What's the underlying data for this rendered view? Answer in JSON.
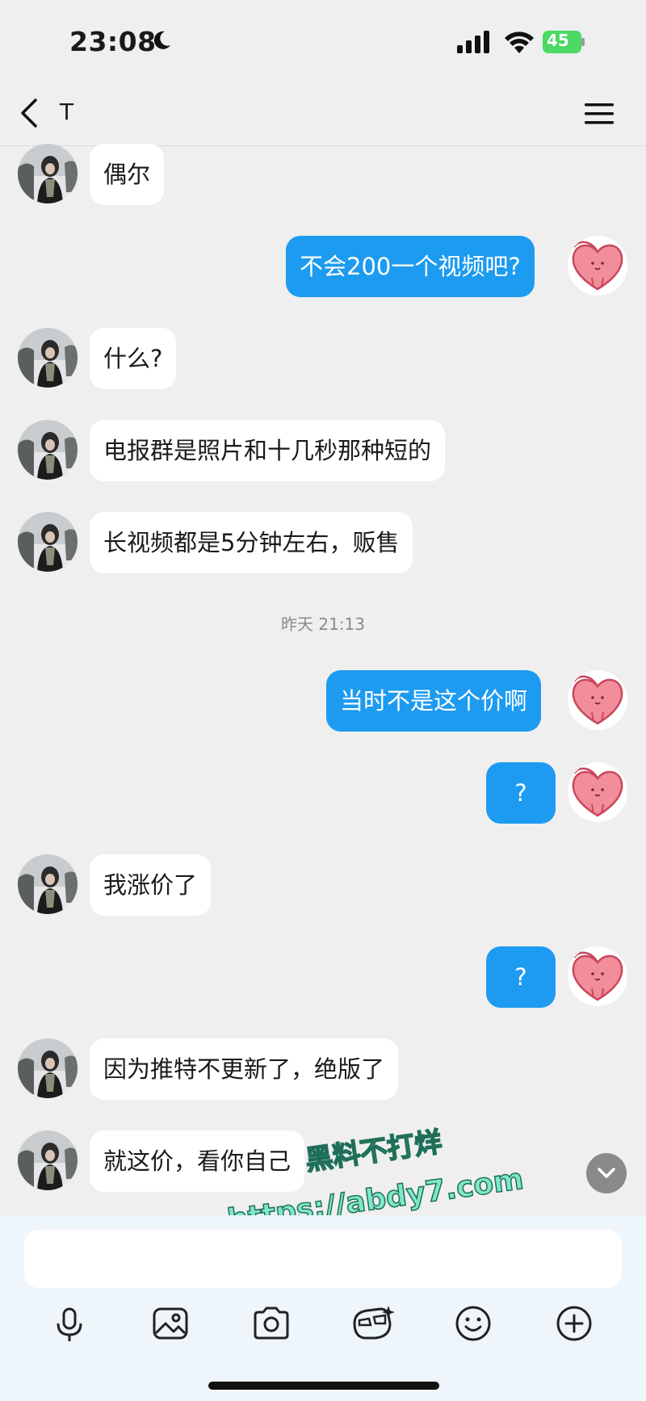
{
  "status_bar": {
    "time": "23:08",
    "battery": "45"
  },
  "header": {
    "title": "T"
  },
  "messages": [
    {
      "dir": "in",
      "text": "偶尔"
    },
    {
      "dir": "out",
      "text": "不会200一个视频吧?"
    },
    {
      "dir": "in",
      "text": "什么?"
    },
    {
      "dir": "in",
      "text": "电报群是照片和十几秒那种短的"
    },
    {
      "dir": "in",
      "text": "长视频都是5分钟左右，贩售"
    },
    {
      "dir": "out",
      "text": "当时不是这个价啊"
    },
    {
      "dir": "out",
      "text": "?"
    },
    {
      "dir": "in",
      "text": "我涨价了"
    },
    {
      "dir": "out",
      "text": "?"
    },
    {
      "dir": "in",
      "text": "因为推特不更新了，绝版了"
    },
    {
      "dir": "in",
      "text": "就这价，看你自己"
    }
  ],
  "timestamp": "昨天 21:13",
  "watermark": {
    "line1": "黑料不打烊",
    "line2": "https://abdy7.com"
  },
  "input": {
    "placeholder": ""
  },
  "toolbar": [
    "mic-icon",
    "image-icon",
    "camera-icon",
    "sticker-icon",
    "emoji-icon",
    "plus-icon"
  ],
  "colors": {
    "outgoing_bubble": "#1d9bf0",
    "incoming_bubble": "#ffffff",
    "background": "#efefef",
    "watermark": "#7fe8c8"
  }
}
